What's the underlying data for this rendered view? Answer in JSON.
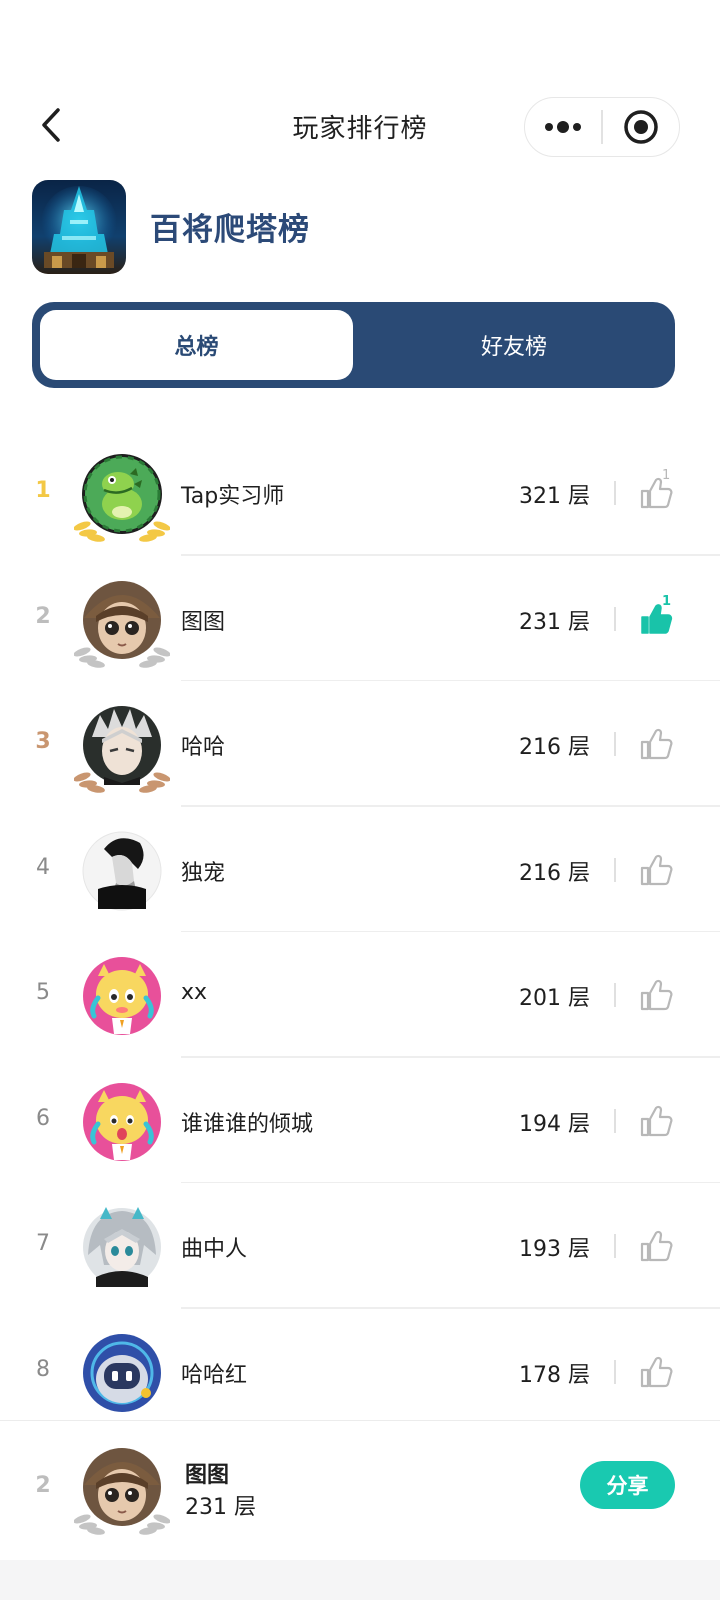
{
  "header": {
    "title": "玩家排行榜",
    "back_icon": "chevron-left-icon",
    "more_icon": "more-dots-icon",
    "close_icon": "target-icon"
  },
  "game": {
    "name": "百将爬塔榜",
    "icon": "tower-game-icon"
  },
  "tabs": {
    "active": "总榜",
    "inactive": "好友榜"
  },
  "colors": {
    "brand_navy": "#2a4a75",
    "title_blue": "#2c4a78",
    "accent_teal": "#19c9b0",
    "gold": "#f3c845",
    "silver": "#bdbdbd",
    "bronze": "#c99670"
  },
  "rows": [
    {
      "rank": "1",
      "name": "Tap实习师",
      "score": "321 层",
      "likes": "1",
      "liked": false
    },
    {
      "rank": "2",
      "name": "图图",
      "score": "231 层",
      "likes": "1",
      "liked": true
    },
    {
      "rank": "3",
      "name": "哈哈",
      "score": "216 层",
      "likes": "",
      "liked": false
    },
    {
      "rank": "4",
      "name": "独宠",
      "score": "216 层",
      "likes": "",
      "liked": false
    },
    {
      "rank": "5",
      "name": "xx",
      "score": "201 层",
      "likes": "",
      "liked": false
    },
    {
      "rank": "6",
      "name": "谁谁谁的倾城",
      "score": "194 层",
      "likes": "",
      "liked": false
    },
    {
      "rank": "7",
      "name": "曲中人",
      "score": "193 层",
      "likes": "",
      "liked": false
    },
    {
      "rank": "8",
      "name": "哈哈红",
      "score": "178 层",
      "likes": "",
      "liked": false
    }
  ],
  "me": {
    "rank": "2",
    "name": "图图",
    "score": "231 层",
    "share_label": "分享"
  }
}
